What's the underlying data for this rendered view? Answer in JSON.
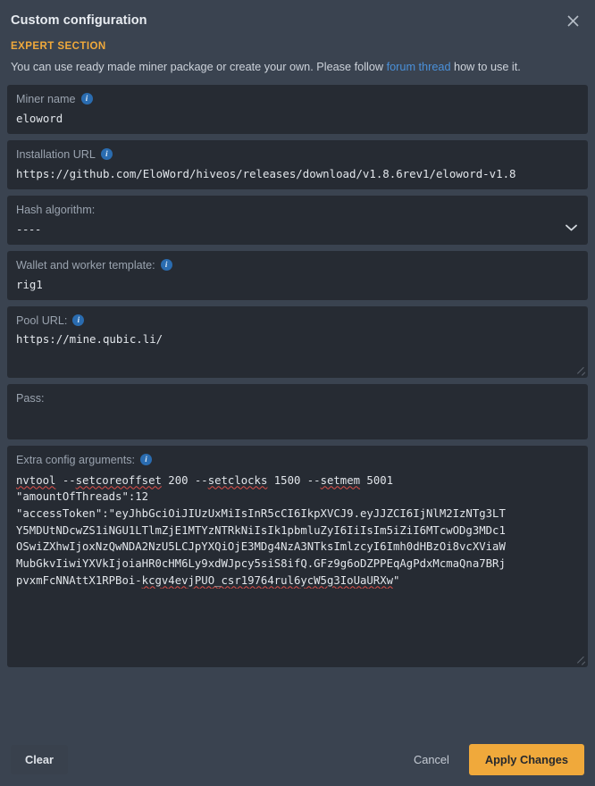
{
  "dialog": {
    "title": "Custom configuration",
    "close_icon": "close-icon"
  },
  "intro": {
    "expert_label": "EXPERT SECTION",
    "text_before": "You can use ready made miner package or create your own. Please follow ",
    "link_text": "forum thread",
    "text_after": " how to use it."
  },
  "fields": {
    "miner_name": {
      "label": "Miner name",
      "info_icon": "i",
      "value": "eloword"
    },
    "installation_url": {
      "label": "Installation URL",
      "info_icon": "i",
      "value": "https://github.com/EloWord/hiveos/releases/download/v1.8.6rev1/eloword-v1.8"
    },
    "hash_algorithm": {
      "label": "Hash algorithm:",
      "value": "----",
      "chevron_icon": "chevron-down-icon"
    },
    "wallet_template": {
      "label": "Wallet and worker template:",
      "info_icon": "i",
      "value": "rig1"
    },
    "pool_url": {
      "label": "Pool URL:",
      "info_icon": "i",
      "value": "https://mine.qubic.li/"
    },
    "pass": {
      "label": "Pass:",
      "value": ""
    },
    "extra_config": {
      "label": "Extra config arguments:",
      "info_icon": "i",
      "lines": [
        "nvtool --setcoreoffset 200 --setclocks 1500 --setmem 5001",
        "\"amountOfThreads\":12",
        "\"accessToken\":\"eyJhbGciOiJIUzUxMiIsInR5cCI6IkpXVCJ9.eyJJZCI6IjNlM2IzNTg3LT",
        "Y5MDUtNDcwZS1iNGU1LTlmZjE1MTYzNTRkNiIsIk1pbmluZyI6IiIsIm5iZiI6MTcwODg3MDc1",
        "OSwiZXhwIjoxNzQwNDA2NzU5LCJpYXQiOjE3MDg4NzA3NTksImlzcyI6Imh0dHBzOi8vcXViaW",
        "MubGkvIiwiYXVkIjoiaHR0cHM6Ly9xdWJpcy5siS8ifQ.GFz9g6oDZPPEqAgPdxMcmaQna7BRj",
        "pvxmFcNNAttX1RPBoi-kcgv4evjPUO_csr19764rul6ycW5g3IoUaURXw\""
      ]
    }
  },
  "footer": {
    "clear_label": "Clear",
    "cancel_label": "Cancel",
    "apply_label": "Apply Changes"
  },
  "colors": {
    "accent": "#f0a93b",
    "link": "#4a90d9",
    "panel_bg": "#3a4350",
    "field_bg": "#262b33",
    "info_badge": "#2a6cb0",
    "spellcheck_underline": "#e0504a"
  }
}
